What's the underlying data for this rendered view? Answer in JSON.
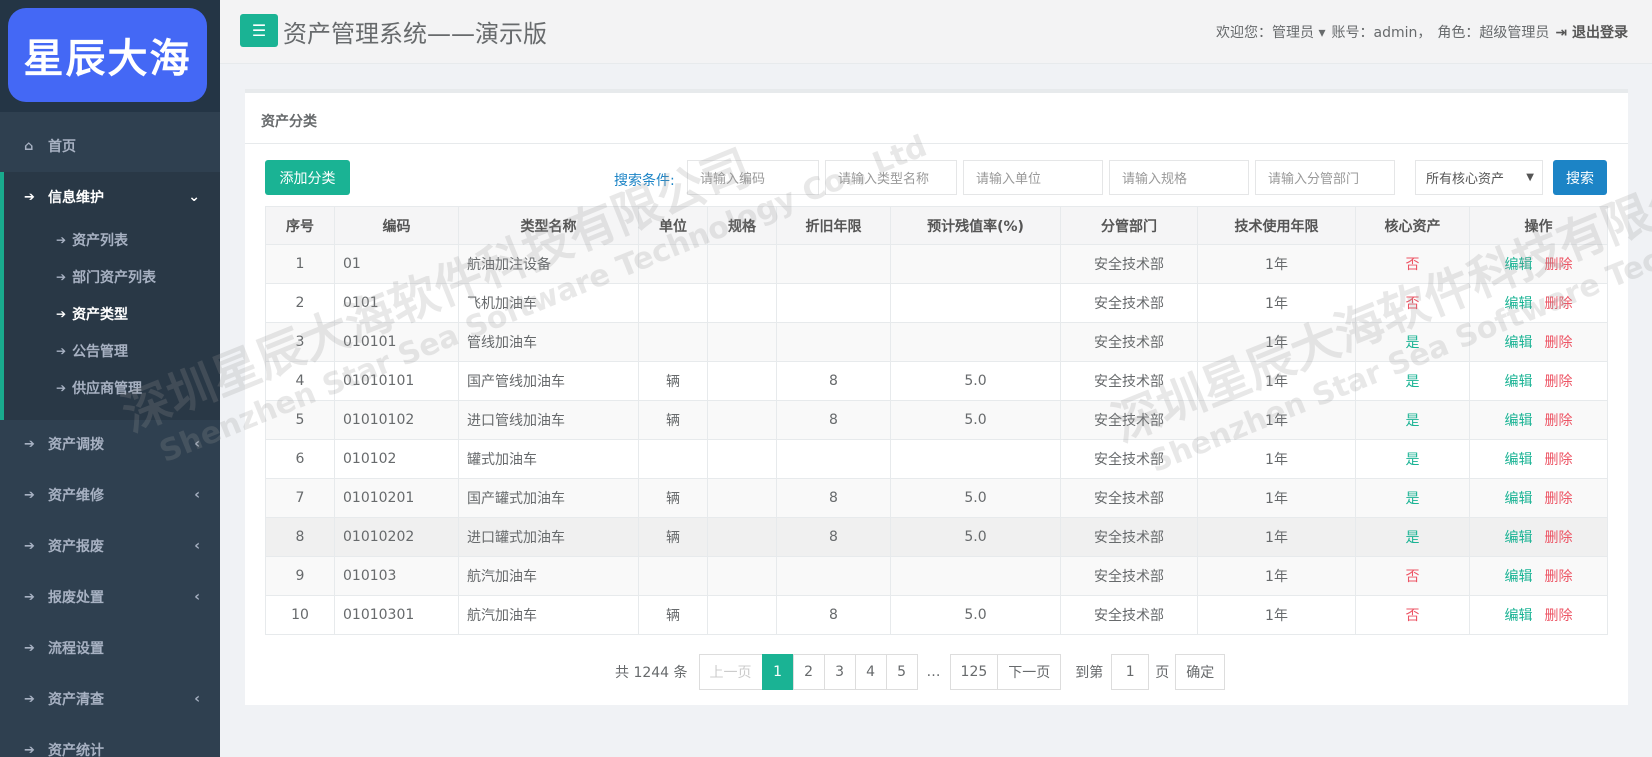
{
  "sidebar": {
    "logo": "星辰大海",
    "items": [
      {
        "label": "首页",
        "icon": "home-icon"
      },
      {
        "label": "信息维护",
        "icon": "arrow-right-icon"
      },
      {
        "label": "资产调拨",
        "icon": "arrow-right-icon"
      },
      {
        "label": "资产维修",
        "icon": "arrow-right-icon"
      },
      {
        "label": "资产报废",
        "icon": "arrow-right-icon"
      },
      {
        "label": "报废处置",
        "icon": "arrow-right-icon"
      },
      {
        "label": "流程设置",
        "icon": "arrow-right-icon"
      },
      {
        "label": "资产清查",
        "icon": "arrow-right-icon"
      },
      {
        "label": "资产统计",
        "icon": "arrow-right-icon"
      }
    ],
    "subitems": [
      {
        "label": "资产列表"
      },
      {
        "label": "部门资产列表"
      },
      {
        "label": "资产类型",
        "active": true
      },
      {
        "label": "公告管理"
      },
      {
        "label": "供应商管理"
      }
    ]
  },
  "header": {
    "title": "资产管理系统——演示版",
    "welcome": "欢迎您：管理员",
    "account": "账号：admin，",
    "role": "角色：超级管理员",
    "logout": "退出登录"
  },
  "panel": {
    "title": "资产分类",
    "add_button": "添加分类",
    "search_label": "搜索条件:",
    "placeholders": {
      "code": "请输入编码",
      "type_name": "请输入类型名称",
      "unit": "请输入单位",
      "spec": "请输入规格",
      "dept": "请输入分管部门"
    },
    "core_select": "所有核心资产",
    "search_button": "搜索"
  },
  "table": {
    "headers": [
      "序号",
      "编码",
      "类型名称",
      "单位",
      "规格",
      "折旧年限",
      "预计残值率(%)",
      "分管部门",
      "技术使用年限",
      "核心资产",
      "操作"
    ],
    "rows": [
      [
        "1",
        "01",
        "航油加注设备",
        "",
        "",
        "",
        "",
        "安全技术部",
        "1年",
        "否"
      ],
      [
        "2",
        "0101",
        "飞机加油车",
        "",
        "",
        "",
        "",
        "安全技术部",
        "1年",
        "否"
      ],
      [
        "3",
        "010101",
        "管线加油车",
        "",
        "",
        "",
        "",
        "安全技术部",
        "1年",
        "是"
      ],
      [
        "4",
        "01010101",
        "国产管线加油车",
        "辆",
        "",
        "8",
        "5.0",
        "安全技术部",
        "1年",
        "是"
      ],
      [
        "5",
        "01010102",
        "进口管线加油车",
        "辆",
        "",
        "8",
        "5.0",
        "安全技术部",
        "1年",
        "是"
      ],
      [
        "6",
        "010102",
        "罐式加油车",
        "",
        "",
        "",
        "",
        "安全技术部",
        "1年",
        "是"
      ],
      [
        "7",
        "01010201",
        "国产罐式加油车",
        "辆",
        "",
        "8",
        "5.0",
        "安全技术部",
        "1年",
        "是"
      ],
      [
        "8",
        "01010202",
        "进口罐式加油车",
        "辆",
        "",
        "8",
        "5.0",
        "安全技术部",
        "1年",
        "是"
      ],
      [
        "9",
        "010103",
        "航汽加油车",
        "",
        "",
        "",
        "",
        "安全技术部",
        "1年",
        "否"
      ],
      [
        "10",
        "01010301",
        "航汽加油车",
        "辆",
        "",
        "8",
        "5.0",
        "安全技术部",
        "1年",
        "否"
      ]
    ],
    "edit_label": "编辑",
    "delete_label": "删除"
  },
  "pagination": {
    "total": "共 1244 条",
    "prev": "上一页",
    "pages": [
      "1",
      "2",
      "3",
      "4",
      "5"
    ],
    "ellipsis": "…",
    "last": "125",
    "next": "下一页",
    "goto_label": "到第",
    "goto_value": "1",
    "goto_unit": "页",
    "confirm": "确定"
  },
  "watermark": {
    "cn": "深圳星辰大海软件科技有限公司",
    "en": "Shenzhen Star Sea Software Technology Co., Ltd"
  },
  "colors": {
    "accent": "#1ab394",
    "primary": "#1c84c6",
    "danger": "#ed5565",
    "sidebar": "#2f4050",
    "logo": "#4468f5"
  }
}
